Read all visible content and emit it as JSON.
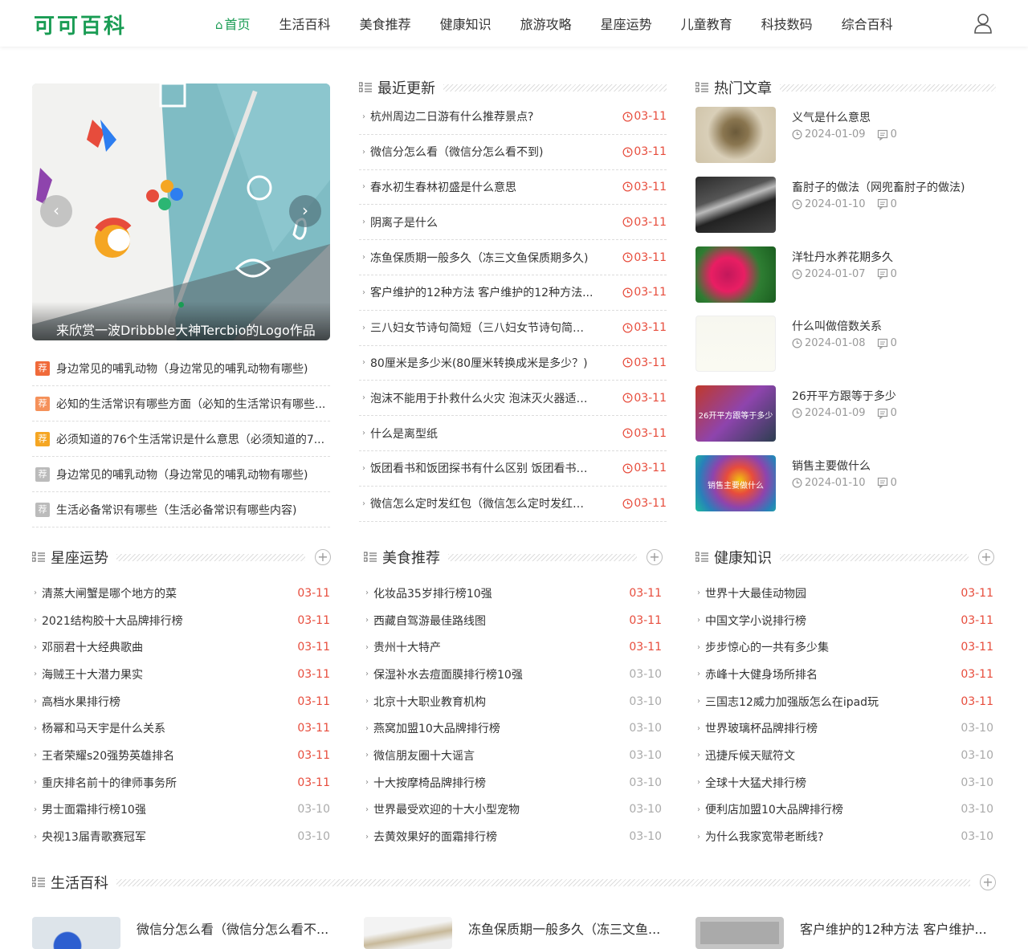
{
  "site": {
    "logo": "可可百科"
  },
  "nav": {
    "items": [
      {
        "label": "首页",
        "active": true
      },
      {
        "label": "生活百科"
      },
      {
        "label": "美食推荐"
      },
      {
        "label": "健康知识"
      },
      {
        "label": "旅游攻略"
      },
      {
        "label": "星座运势"
      },
      {
        "label": "儿童教育"
      },
      {
        "label": "科技数码"
      },
      {
        "label": "综合百科"
      }
    ]
  },
  "slider": {
    "caption": "来欣赏一波Dribbble大神Tercbio的Logo作品"
  },
  "recommend": {
    "badge": "荐",
    "items": [
      {
        "text": "身边常见的哺乳动物（身边常见的哺乳动物有哪些)",
        "color": "#f06a3a"
      },
      {
        "text": "必知的生活常识有哪些方面（必知的生活常识有哪些...",
        "color": "#f5915a"
      },
      {
        "text": "必须知道的76个生活常识是什么意思（必须知道的7...",
        "color": "#f5a623"
      },
      {
        "text": "身边常见的哺乳动物（身边常见的哺乳动物有哪些)",
        "color": "#bbbbbb"
      },
      {
        "text": "生活必备常识有哪些（生活必备常识有哪些内容)",
        "color": "#bbbbbb"
      }
    ]
  },
  "recent": {
    "title": "最近更新",
    "items": [
      {
        "text": "杭州周边二日游有什么推荐景点?",
        "date": "03-11"
      },
      {
        "text": "微信分怎么看（微信分怎么看不到)",
        "date": "03-11"
      },
      {
        "text": "春水初生春林初盛是什么意思",
        "date": "03-11"
      },
      {
        "text": "阴离子是什么",
        "date": "03-11"
      },
      {
        "text": "冻鱼保质期一般多久（冻三文鱼保质期多久)",
        "date": "03-11"
      },
      {
        "text": "客户维护的12种方法 客户维护的12种方法...",
        "date": "03-11"
      },
      {
        "text": "三八妇女节诗句简短（三八妇女节诗句简短...",
        "date": "03-11"
      },
      {
        "text": "80厘米是多少米(80厘米转换成米是多少？)",
        "date": "03-11"
      },
      {
        "text": "泡沫不能用于扑救什么火灾 泡沫灭火器适用...",
        "date": "03-11"
      },
      {
        "text": "什么是离型纸",
        "date": "03-11"
      },
      {
        "text": "饭团看书和饭团探书有什么区别 饭团看书和...",
        "date": "03-11"
      },
      {
        "text": "微信怎么定时发红包（微信怎么定时发红包 ...",
        "date": "03-11"
      }
    ]
  },
  "hot": {
    "title": "热门文章",
    "items": [
      {
        "title": "义气是什么意思",
        "date": "2024-01-09",
        "comments": "0",
        "thumb_label": ""
      },
      {
        "title": "畜肘子的做法（网兜畜肘子的做法)",
        "date": "2024-01-10",
        "comments": "0",
        "thumb_label": ""
      },
      {
        "title": "洋牡丹水养花期多久",
        "date": "2024-01-07",
        "comments": "0",
        "thumb_label": ""
      },
      {
        "title": "什么叫做倍数关系",
        "date": "2024-01-08",
        "comments": "0",
        "thumb_label": ""
      },
      {
        "title": "26开平方跟等于多少",
        "date": "2024-01-09",
        "comments": "0",
        "thumb_label": "26开平方跟等于多少"
      },
      {
        "title": "销售主要做什么",
        "date": "2024-01-10",
        "comments": "0",
        "thumb_label": "销售主要做什么"
      }
    ]
  },
  "sections": [
    {
      "title": "星座运势",
      "items": [
        {
          "text": "清蒸大闸蟹是哪个地方的菜",
          "date": "03-11",
          "recent": true
        },
        {
          "text": "2021结构胶十大品牌排行榜",
          "date": "03-11",
          "recent": true
        },
        {
          "text": "邓丽君十大经典歌曲",
          "date": "03-11",
          "recent": true
        },
        {
          "text": "海贼王十大潜力果实",
          "date": "03-11",
          "recent": true
        },
        {
          "text": "高档水果排行榜",
          "date": "03-11",
          "recent": true
        },
        {
          "text": "杨幂和马天宇是什么关系",
          "date": "03-11",
          "recent": true
        },
        {
          "text": "王者荣耀s20强势英雄排名",
          "date": "03-11",
          "recent": true
        },
        {
          "text": "重庆排名前十的律师事务所",
          "date": "03-11",
          "recent": true
        },
        {
          "text": "男士面霜排行榜10强",
          "date": "03-10",
          "recent": false
        },
        {
          "text": "央视13届青歌赛冠军",
          "date": "03-10",
          "recent": false
        }
      ]
    },
    {
      "title": "美食推荐",
      "items": [
        {
          "text": "化妆品35岁排行榜10强",
          "date": "03-11",
          "recent": true
        },
        {
          "text": "西藏自驾游最佳路线图",
          "date": "03-11",
          "recent": true
        },
        {
          "text": "贵州十大特产",
          "date": "03-11",
          "recent": true
        },
        {
          "text": "保湿补水去痘面膜排行榜10强",
          "date": "03-10",
          "recent": false
        },
        {
          "text": "北京十大职业教育机构",
          "date": "03-10",
          "recent": false
        },
        {
          "text": "燕窝加盟10大品牌排行榜",
          "date": "03-10",
          "recent": false
        },
        {
          "text": "微信朋友圈十大谣言",
          "date": "03-10",
          "recent": false
        },
        {
          "text": "十大按摩椅品牌排行榜",
          "date": "03-10",
          "recent": false
        },
        {
          "text": "世界最受欢迎的十大小型宠物",
          "date": "03-10",
          "recent": false
        },
        {
          "text": "去黄效果好的面霜排行榜",
          "date": "03-10",
          "recent": false
        }
      ]
    },
    {
      "title": "健康知识",
      "items": [
        {
          "text": "世界十大最佳动物园",
          "date": "03-11",
          "recent": true
        },
        {
          "text": "中国文学小说排行榜",
          "date": "03-11",
          "recent": true
        },
        {
          "text": "步步惊心的一共有多少集",
          "date": "03-11",
          "recent": true
        },
        {
          "text": "赤峰十大健身场所排名",
          "date": "03-11",
          "recent": true
        },
        {
          "text": "三国志12威力加强版怎么在ipad玩",
          "date": "03-11",
          "recent": true
        },
        {
          "text": "世界玻璃杯品牌排行榜",
          "date": "03-10",
          "recent": false
        },
        {
          "text": "迅捷斥候天赋符文",
          "date": "03-10",
          "recent": false
        },
        {
          "text": "全球十大猛犬排行榜",
          "date": "03-10",
          "recent": false
        },
        {
          "text": "便利店加盟10大品牌排行榜",
          "date": "03-10",
          "recent": false
        },
        {
          "text": "为什么我家宽带老断线?",
          "date": "03-10",
          "recent": false
        }
      ]
    }
  ],
  "life": {
    "title": "生活百科",
    "cards": [
      {
        "title": "微信分怎么看（微信分怎么看不..."
      },
      {
        "title": "冻鱼保质期一般多久（冻三文鱼..."
      },
      {
        "title": "客户维护的12种方法 客户维护..."
      }
    ]
  }
}
